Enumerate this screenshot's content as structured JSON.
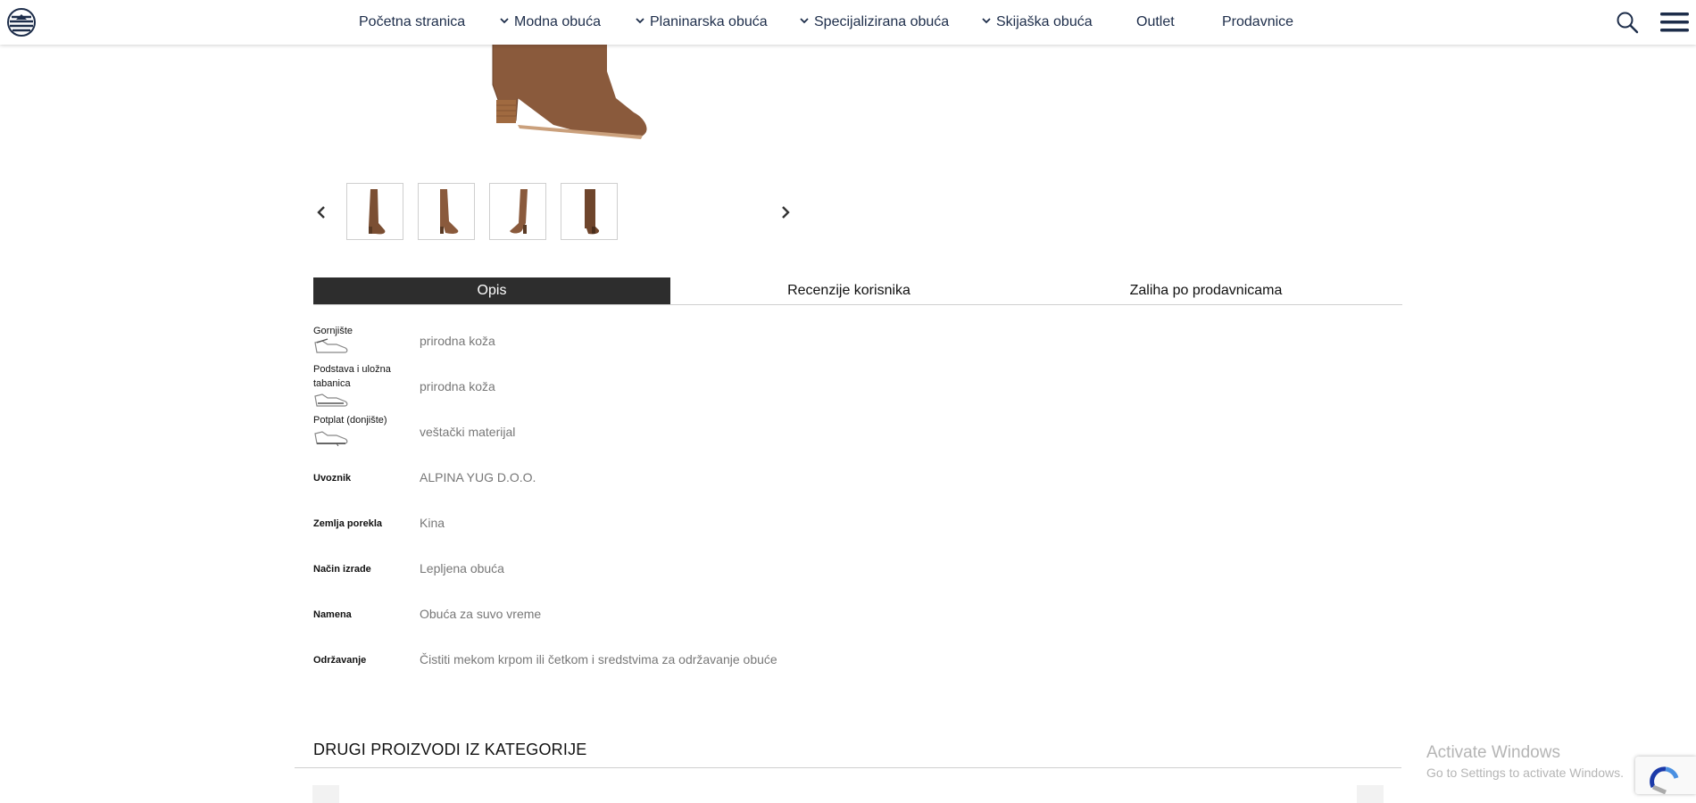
{
  "nav": {
    "items": [
      {
        "label": "Početna stranica",
        "dropdown": false
      },
      {
        "label": "Modna obuća",
        "dropdown": true
      },
      {
        "label": "Planinarska obuća",
        "dropdown": true
      },
      {
        "label": "Specijalizirana obuća",
        "dropdown": true
      },
      {
        "label": "Skijaška obuća",
        "dropdown": true
      },
      {
        "label": "Outlet",
        "dropdown": false
      },
      {
        "label": "Prodavnice",
        "dropdown": false
      }
    ]
  },
  "icons": {
    "logo": "brand-logo-icon",
    "search": "search-icon",
    "menu": "hamburger-menu-icon",
    "prev": "chevron-left-icon",
    "next": "chevron-right-icon"
  },
  "gallery": {
    "thumbnails": [
      "boot-thumbnail-1",
      "boot-thumbnail-2",
      "boot-thumbnail-3",
      "boot-thumbnail-4"
    ]
  },
  "tabs": [
    {
      "label": "Opis",
      "active": true
    },
    {
      "label": "Recenzije korisnika",
      "active": false
    },
    {
      "label": "Zaliha po prodavnicama",
      "active": false
    }
  ],
  "specs": [
    {
      "label": "Gornjište",
      "value": "prirodna koža"
    },
    {
      "label": "Podstava i uložna tabanica",
      "value": "prirodna koža"
    },
    {
      "label": "Potplat (donjište)",
      "value": "veštački materijal"
    },
    {
      "label": "Uvoznik",
      "value": "ALPINA YUG D.O.O."
    },
    {
      "label": "Zemlja porekla",
      "value": "Kina"
    },
    {
      "label": "Način izrade",
      "value": "Lepljena obuća"
    },
    {
      "label": "Namena",
      "value": "Obuća za suvo vreme"
    },
    {
      "label": "Održavanje",
      "value": "Čistiti mekom krpom ili četkom i sredstvima za održavanje obuće"
    }
  ],
  "related": {
    "title": "DRUGI PROIZVODI IZ KATEGORIJE"
  },
  "watermark": {
    "title": "Activate Windows",
    "subtitle": "Go to Settings to activate Windows."
  },
  "colors": {
    "nav_text": "#1d2d4a",
    "active_tab_bg": "#2d2d2d",
    "boot_brown": "#8a5a3c",
    "value_gray": "#777777"
  }
}
